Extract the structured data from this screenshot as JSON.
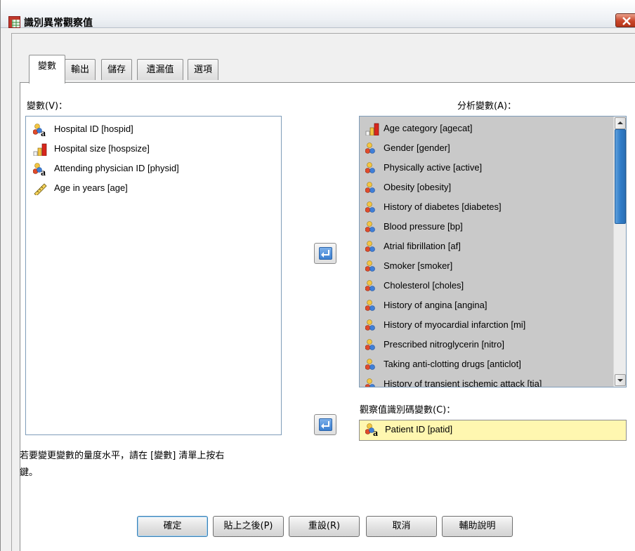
{
  "window": {
    "title": "識別異常觀察值"
  },
  "tabs": [
    {
      "label": "變數",
      "active": true
    },
    {
      "label": "輸出"
    },
    {
      "label": "儲存"
    },
    {
      "label": "遺漏值"
    },
    {
      "label": "選項"
    }
  ],
  "variables": {
    "label": "變數(V)：",
    "items": [
      {
        "label": "Hospital ID [hospid]",
        "icon": "nominal-string-icon"
      },
      {
        "label": "Hospital size [hospsize]",
        "icon": "ordinal-icon"
      },
      {
        "label": "Attending physician ID [physid]",
        "icon": "nominal-string-icon"
      },
      {
        "label": "Age in years [age]",
        "icon": "scale-ruler-icon"
      }
    ]
  },
  "analysis": {
    "label": "分析變數(A)：",
    "items": [
      {
        "label": "Age category [agecat]",
        "icon": "ordinal-icon"
      },
      {
        "label": "Gender [gender]",
        "icon": "nominal-icon"
      },
      {
        "label": "Physically active [active]",
        "icon": "nominal-icon"
      },
      {
        "label": "Obesity [obesity]",
        "icon": "nominal-icon"
      },
      {
        "label": "History of diabetes [diabetes]",
        "icon": "nominal-icon"
      },
      {
        "label": "Blood pressure [bp]",
        "icon": "nominal-icon"
      },
      {
        "label": "Atrial fibrillation [af]",
        "icon": "nominal-icon"
      },
      {
        "label": "Smoker [smoker]",
        "icon": "nominal-icon"
      },
      {
        "label": "Cholesterol [choles]",
        "icon": "nominal-icon"
      },
      {
        "label": "History of angina [angina]",
        "icon": "nominal-icon"
      },
      {
        "label": "History of myocardial infarction [mi]",
        "icon": "nominal-icon"
      },
      {
        "label": "Prescribed nitroglycerin [nitro]",
        "icon": "nominal-icon"
      },
      {
        "label": "Taking anti-clotting drugs [anticlot]",
        "icon": "nominal-icon"
      },
      {
        "label": "History of transient ischemic attack [tia]",
        "icon": "nominal-icon"
      }
    ]
  },
  "case_id": {
    "label": "觀察值識別碼變數(C)：",
    "value": "Patient ID [patid]",
    "icon": "nominal-string-icon"
  },
  "hint": {
    "line1": "若要變更變數的量度水平，請在 [變數] 清單上按右",
    "line2": "鍵。"
  },
  "buttons": {
    "ok": "確定",
    "paste": "貼上之後(P)",
    "reset": "重設(R)",
    "cancel": "取消",
    "help": "輔助說明"
  },
  "colors": {
    "selected_list_bg": "#c9c9c9",
    "case_id_bg": "#fff7b0",
    "scroll_thumb": "#2f7bc7"
  }
}
